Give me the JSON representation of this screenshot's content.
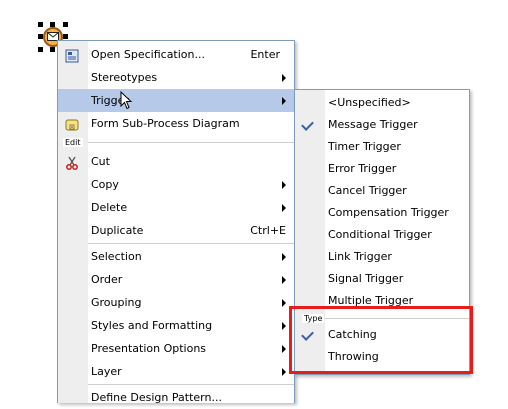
{
  "main_menu": {
    "items": [
      {
        "label": "Open Specification...",
        "shortcut": "Enter",
        "icon": "specification-icon"
      },
      {
        "label": "Stereotypes",
        "submenu": true
      },
      {
        "label": "Trigger",
        "submenu": true,
        "highlighted": true
      },
      {
        "label": "Form Sub-Process Diagram",
        "icon": "subprocess-diagram-icon"
      }
    ],
    "edit_group_label": "Edit",
    "edit_items": [
      {
        "label": "Cut",
        "icon": "scissors-icon"
      },
      {
        "label": "Copy",
        "submenu": true
      },
      {
        "label": "Delete",
        "submenu": true
      },
      {
        "label": "Duplicate",
        "shortcut": "Ctrl+E"
      }
    ],
    "view_items": [
      {
        "label": "Selection",
        "submenu": true
      },
      {
        "label": "Order",
        "submenu": true
      },
      {
        "label": "Grouping",
        "submenu": true
      },
      {
        "label": "Styles and Formatting",
        "submenu": true
      },
      {
        "label": "Presentation Options",
        "submenu": true
      },
      {
        "label": "Layer",
        "submenu": true
      }
    ],
    "bottom_items": [
      {
        "label": "Define Design Pattern..."
      }
    ]
  },
  "trigger_submenu": {
    "items": [
      {
        "label": "<Unspecified>",
        "checked": false
      },
      {
        "label": "Message Trigger",
        "checked": true
      },
      {
        "label": "Timer Trigger",
        "checked": false
      },
      {
        "label": "Error Trigger",
        "checked": false
      },
      {
        "label": "Cancel Trigger",
        "checked": false
      },
      {
        "label": "Compensation Trigger",
        "checked": false
      },
      {
        "label": "Conditional Trigger",
        "checked": false
      },
      {
        "label": "Link Trigger",
        "checked": false
      },
      {
        "label": "Signal Trigger",
        "checked": false
      },
      {
        "label": "Multiple Trigger",
        "checked": false
      }
    ],
    "type_group_label": "Type",
    "type_items": [
      {
        "label": "Catching",
        "checked": true
      },
      {
        "label": "Throwing",
        "checked": false
      }
    ]
  },
  "colors": {
    "highlight": "#b6c9e9",
    "callout_border": "#e81c1c",
    "event_fill": "#f6b14a"
  }
}
